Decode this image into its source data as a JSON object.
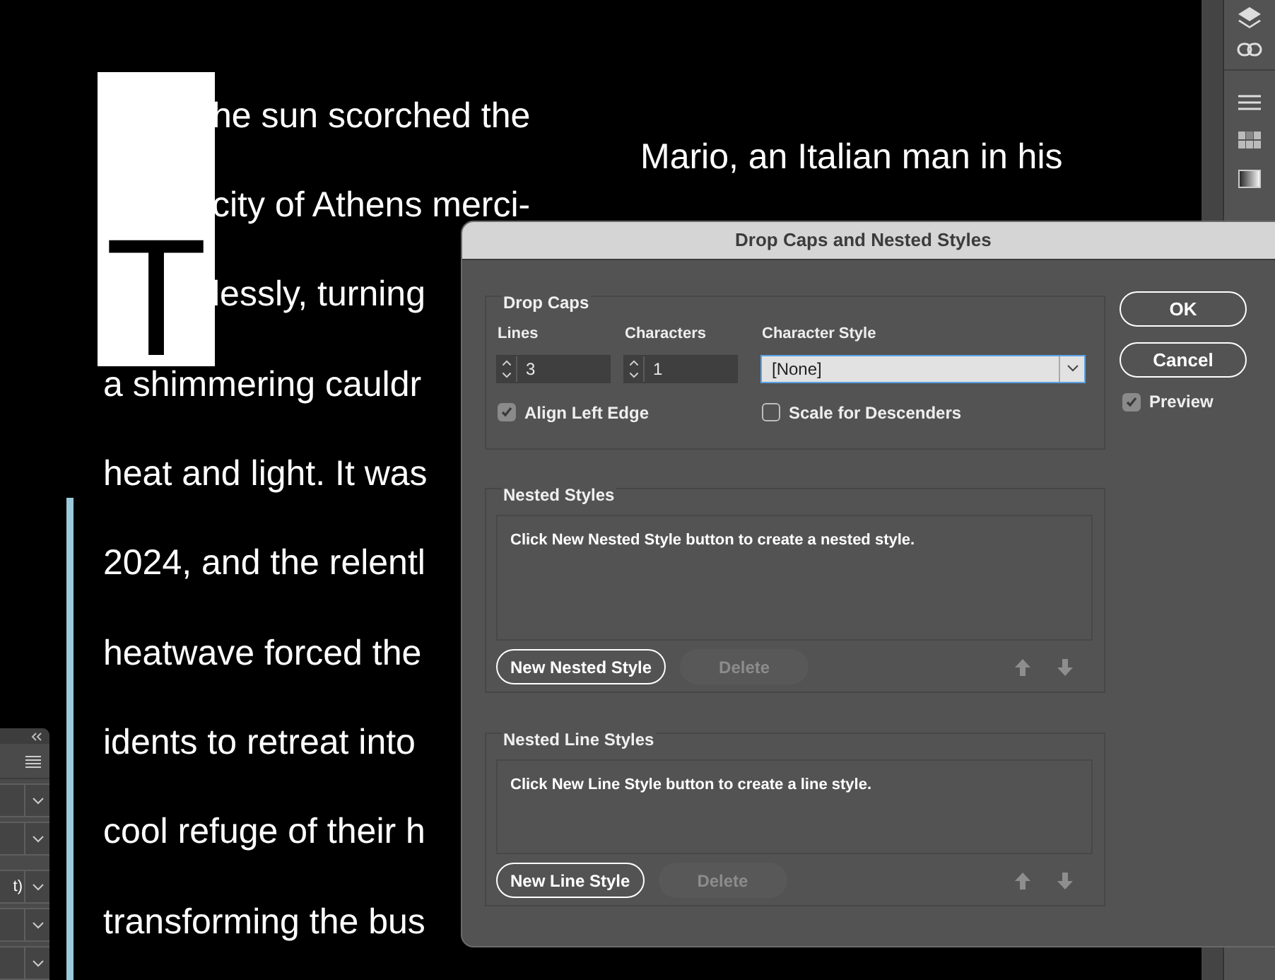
{
  "document": {
    "drop_cap": "T",
    "left_column": [
      "he sun scorched the",
      "city of Athens merci-",
      "lessly, turning",
      "a shimmering cauldr",
      "heat and light. It was",
      "2024, and the relentl",
      "heatwave forced the",
      "idents to retreat into",
      "cool refuge of their h",
      "transforming the bus"
    ],
    "right_column": [
      "Mario, an Italian man in his"
    ]
  },
  "left_panel": {
    "rows": [
      {
        "kind": "dropdown"
      },
      {
        "kind": "dropdown"
      },
      {
        "kind": "dropdown",
        "value": "t)"
      },
      {
        "kind": "dropdown"
      },
      {
        "kind": "dropdown"
      }
    ]
  },
  "dialog": {
    "title": "Drop Caps and Nested Styles",
    "drop_caps": {
      "legend": "Drop Caps",
      "lines": {
        "label": "Lines",
        "value": "3"
      },
      "characters": {
        "label": "Characters",
        "value": "1"
      },
      "character_style": {
        "label": "Character Style",
        "value": "[None]"
      },
      "checkboxes": [
        {
          "label": "Align Left Edge",
          "checked": true
        },
        {
          "label": "Scale for Descenders",
          "checked": false
        }
      ]
    },
    "sections": [
      {
        "legend": "Nested Styles",
        "hint": "Click New Nested Style button to create a nested style.",
        "new_button": "New Nested Style",
        "delete_button": {
          "label": "Delete",
          "disabled": true
        }
      },
      {
        "legend": "Nested Line Styles",
        "hint": "Click New Line Style button to create a line style.",
        "new_button": "New Line Style",
        "delete_button": {
          "label": "Delete",
          "disabled": true
        }
      }
    ],
    "buttons": [
      {
        "label": "OK"
      },
      {
        "label": "Cancel"
      }
    ],
    "preview": {
      "label": "Preview",
      "checked": true
    }
  }
}
